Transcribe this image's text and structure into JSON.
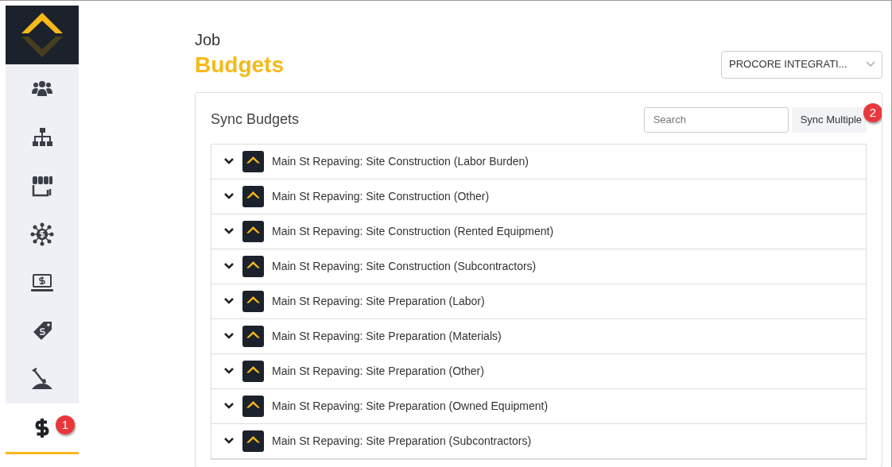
{
  "sidebar": {
    "items": [
      {
        "kind": "people",
        "selected": false
      },
      {
        "kind": "org-chart",
        "selected": false
      },
      {
        "kind": "storefront",
        "selected": false
      },
      {
        "kind": "network-dollar",
        "selected": false
      },
      {
        "kind": "laptop-dollar",
        "selected": false
      },
      {
        "kind": "price-tag",
        "selected": false
      },
      {
        "kind": "shovel",
        "selected": false
      },
      {
        "kind": "dollar",
        "selected": true,
        "badge": "1"
      }
    ]
  },
  "page": {
    "eyebrow": "Job",
    "title": "Budgets"
  },
  "integration_select": {
    "value": "PROCORE INTEGRATI..."
  },
  "card": {
    "title": "Sync Budgets",
    "search": {
      "placeholder": "Search"
    },
    "sync_button": {
      "label": "Sync Multiple",
      "badge": "2"
    },
    "rows": [
      {
        "label": "Main St Repaving: Site Construction (Labor Burden)"
      },
      {
        "label": "Main St Repaving: Site Construction (Other)"
      },
      {
        "label": "Main St Repaving: Site Construction (Rented Equipment)"
      },
      {
        "label": "Main St Repaving: Site Construction (Subcontractors)"
      },
      {
        "label": "Main St Repaving: Site Preparation (Labor)"
      },
      {
        "label": "Main St Repaving: Site Preparation (Materials)"
      },
      {
        "label": "Main St Repaving: Site Preparation (Other)"
      },
      {
        "label": "Main St Repaving: Site Preparation (Owned Equipment)"
      },
      {
        "label": "Main St Repaving: Site Preparation (Subcontractors)"
      }
    ]
  }
}
